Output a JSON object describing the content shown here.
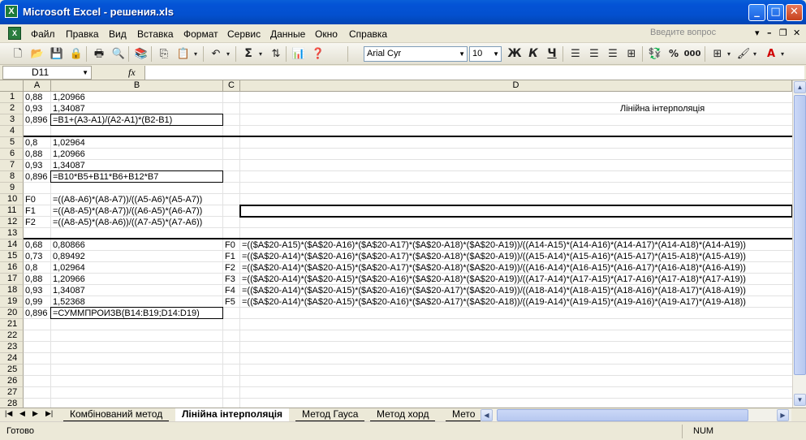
{
  "window": {
    "title": "Microsoft Excel - решения.xls",
    "app_icon": "excel-icon",
    "minimize": "_",
    "maximize": "□",
    "close": "✕"
  },
  "menu": {
    "items": [
      "Файл",
      "Правка",
      "Вид",
      "Вставка",
      "Формат",
      "Сервис",
      "Данные",
      "Окно",
      "Справка"
    ],
    "help_placeholder": "Введите вопрос"
  },
  "toolbar": {
    "font_name": "Arial Cyr",
    "font_size": "10",
    "bold": "Ж",
    "italic": "К",
    "underline": "Ч",
    "sigma": "Σ",
    "percent": "%",
    "thousands": "000"
  },
  "formula_bar": {
    "name_box": "D11",
    "fx": "fx",
    "formula": ""
  },
  "columns": [
    "A",
    "B",
    "C",
    "D"
  ],
  "rows": [
    "1",
    "2",
    "3",
    "4",
    "5",
    "6",
    "7",
    "8",
    "9",
    "10",
    "11",
    "12",
    "13",
    "14",
    "15",
    "16",
    "17",
    "18",
    "19",
    "20",
    "21",
    "22",
    "23",
    "24",
    "25",
    "26",
    "27",
    "28"
  ],
  "cells": {
    "A1": "0,88",
    "B1": "1,20966",
    "A2": "0,93",
    "B2": "1,34087",
    "D2": "Лінійна інтерполяція",
    "A3": "0,896",
    "B3": "=B1+(A3-A1)/(A2-A1)*(B2-B1)",
    "A5": "0,8",
    "B5": "1,02964",
    "A6": "0,88",
    "B6": "1,20966",
    "A7": "0,93",
    "B7": "1,34087",
    "A8": "0,896",
    "B8": "=B10*B5+B11*B6+B12*B7",
    "A10": "F0",
    "B10": "=((A8-A6)*(A8-A7))/((A5-A6)*(A5-A7))",
    "A11": "F1",
    "B11": "=((A8-A5)*(A8-A7))/((A6-A5)*(A6-A7))",
    "A12": "F2",
    "B12": "=((A8-A5)*(A8-A6))/((A7-A5)*(A7-A6))",
    "A14": "0,68",
    "B14": "0,80866",
    "C14": "F0",
    "D14": "=(($A$20-A15)*($A$20-A16)*($A$20-A17)*($A$20-A18)*($A$20-A19))/((A14-A15)*(A14-A16)*(A14-A17)*(A14-A18)*(A14-A19))",
    "A15": "0,73",
    "B15": "0,89492",
    "C15": "F1",
    "D15": "=(($A$20-A14)*($A$20-A16)*($A$20-A17)*($A$20-A18)*($A$20-A19))/((A15-A14)*(A15-A16)*(A15-A17)*(A15-A18)*(A15-A19))",
    "A16": "0,8",
    "B16": "1,02964",
    "C16": "F2",
    "D16": "=(($A$20-A14)*($A$20-A15)*($A$20-A17)*($A$20-A18)*($A$20-A19))/((A16-A14)*(A16-A15)*(A16-A17)*(A16-A18)*(A16-A19))",
    "A17": "0,88",
    "B17": "1,20966",
    "C17": "F3",
    "D17": "=(($A$20-A14)*($A$20-A15)*($A$20-A16)*($A$20-A18)*($A$20-A19))/((A17-A14)*(A17-A15)*(A17-A16)*(A17-A18)*(A17-A19))",
    "A18": "0,93",
    "B18": "1,34087",
    "C18": "F4",
    "D18": "=(($A$20-A14)*($A$20-A15)*($A$20-A16)*($A$20-A17)*($A$20-A19))/((A18-A14)*(A18-A15)*(A18-A16)*(A18-A17)*(A18-A19))",
    "A19": "0,99",
    "B19": "1,52368",
    "C19": "F5",
    "D19": "=(($A$20-A14)*($A$20-A15)*($A$20-A16)*($A$20-A17)*($A$20-A18))/((A19-A14)*(A19-A15)*(A19-A16)*(A19-A17)*(A19-A18))",
    "A20": "0,896",
    "B20": "=СУММПРОИЗВ(B14:B19;D14:D19)"
  },
  "sheets": {
    "tabs": [
      "Комбінований метод",
      "Лінійна інтерполяція",
      "Метод Гауса",
      "Метод хорд",
      "Мето"
    ],
    "active": "Лінійна інтерполяція"
  },
  "status": {
    "ready": "Готово",
    "num": "NUM"
  }
}
